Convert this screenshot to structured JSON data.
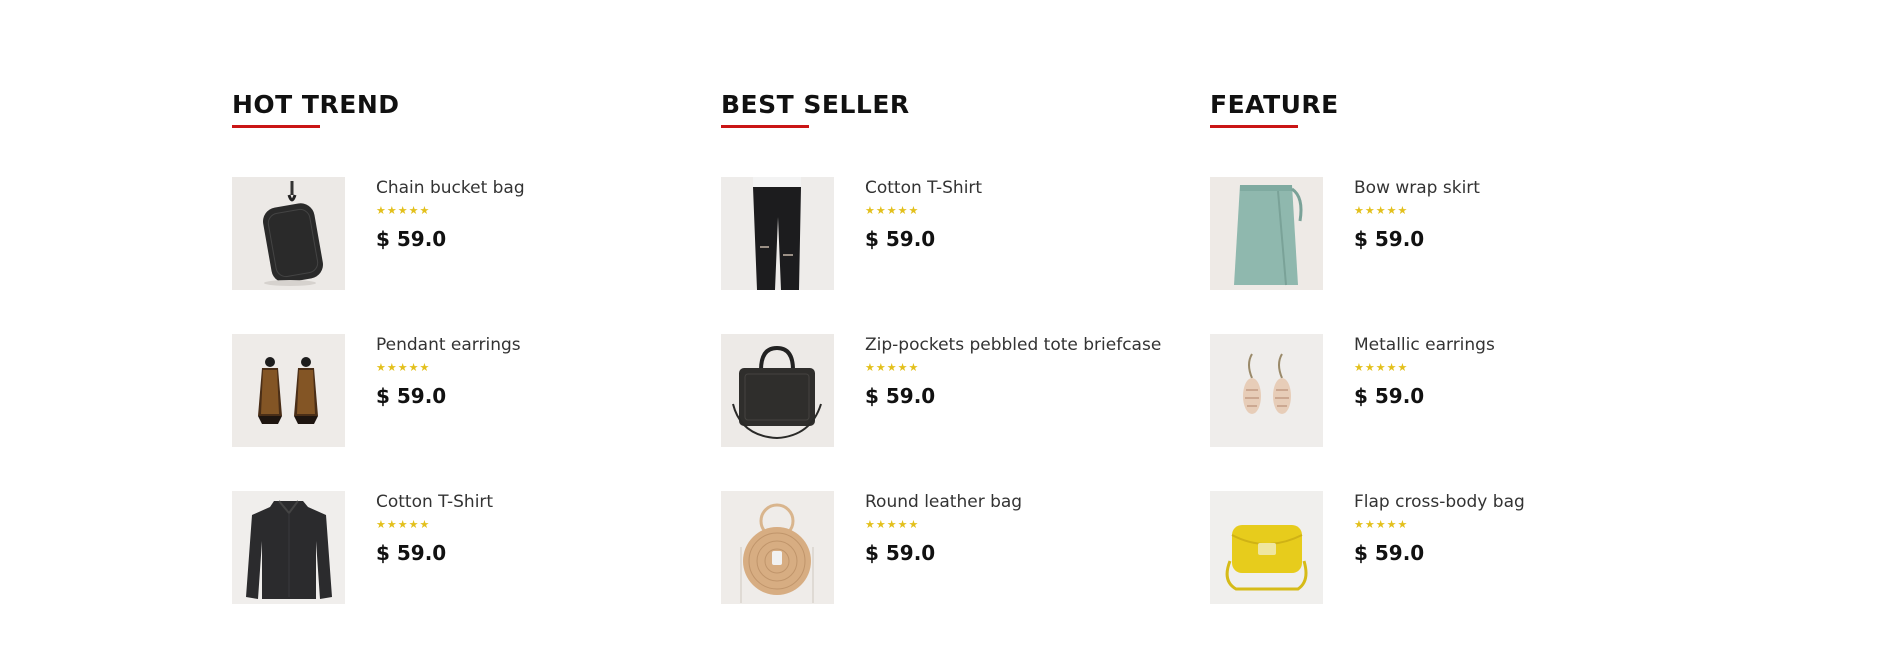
{
  "colors": {
    "accent_underline": "#ca1515",
    "star": "#e3c01c",
    "thumb_background": "#efedeb"
  },
  "sections": [
    {
      "title": "HOT TREND",
      "products": [
        {
          "name": "Chain bucket bag",
          "rating": 5,
          "price": "$ 59.0",
          "icon": "chain-bucket-bag-image"
        },
        {
          "name": "Pendant earrings",
          "rating": 5,
          "price": "$ 59.0",
          "icon": "pendant-earrings-image"
        },
        {
          "name": "Cotton T-Shirt",
          "rating": 5,
          "price": "$ 59.0",
          "icon": "dark-knit-top-image"
        }
      ]
    },
    {
      "title": "BEST SELLER",
      "products": [
        {
          "name": "Cotton T-Shirt",
          "rating": 5,
          "price": "$ 59.0",
          "icon": "black-ripped-jeans-image"
        },
        {
          "name": "Zip-pockets pebbled tote briefcase",
          "rating": 5,
          "price": "$ 59.0",
          "icon": "black-briefcase-image"
        },
        {
          "name": "Round leather bag",
          "rating": 5,
          "price": "$ 59.0",
          "icon": "round-rattan-bag-image"
        }
      ]
    },
    {
      "title": "FEATURE",
      "products": [
        {
          "name": "Bow wrap skirt",
          "rating": 5,
          "price": "$ 59.0",
          "icon": "green-wrap-skirt-image"
        },
        {
          "name": "Metallic earrings",
          "rating": 5,
          "price": "$ 59.0",
          "icon": "shell-earrings-image"
        },
        {
          "name": "Flap cross-body bag",
          "rating": 5,
          "price": "$ 59.0",
          "icon": "yellow-crossbody-bag-image"
        }
      ]
    }
  ]
}
